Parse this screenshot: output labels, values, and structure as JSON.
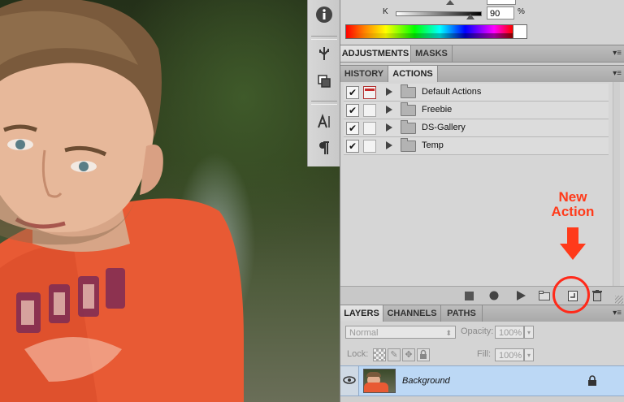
{
  "colors": {
    "panel_bg": "#cfcfcf",
    "selected_row": "#bcd8f5",
    "annotation": "#ff3a1a"
  },
  "color_panel": {
    "k_label": "K",
    "k_value": "90",
    "percent_symbol": "%"
  },
  "adjustments_tabs": [
    {
      "label": "ADJUSTMENTS",
      "active": true
    },
    {
      "label": "MASKS",
      "active": false
    }
  ],
  "actions_tabs": [
    {
      "label": "HISTORY",
      "active": false
    },
    {
      "label": "ACTIONS",
      "active": true
    }
  ],
  "actions": [
    {
      "label": "Default Actions",
      "checked": true,
      "dialog_red": true
    },
    {
      "label": "Freebie",
      "checked": true,
      "dialog_red": false
    },
    {
      "label": "DS-Gallery",
      "checked": true,
      "dialog_red": false
    },
    {
      "label": "Temp",
      "checked": true,
      "dialog_red": false
    }
  ],
  "annotation": {
    "line1": "New",
    "line2": "Action"
  },
  "layers_tabs": [
    {
      "label": "LAYERS",
      "active": true
    },
    {
      "label": "CHANNELS",
      "active": false
    },
    {
      "label": "PATHS",
      "active": false
    }
  ],
  "layers": {
    "blend_mode": "Normal",
    "opacity_label": "Opacity:",
    "opacity_value": "100%",
    "lock_label": "Lock:",
    "fill_label": "Fill:",
    "fill_value": "100%",
    "layer_name": "Background"
  },
  "icons": {
    "tools": [
      "info-icon",
      "usb-plugin-icon",
      "clone-source-icon",
      "character-icon",
      "paragraph-icon"
    ],
    "bottom_bar": [
      "stop-icon",
      "record-icon",
      "play-icon",
      "new-set-icon",
      "new-action-icon",
      "trash-icon"
    ]
  }
}
